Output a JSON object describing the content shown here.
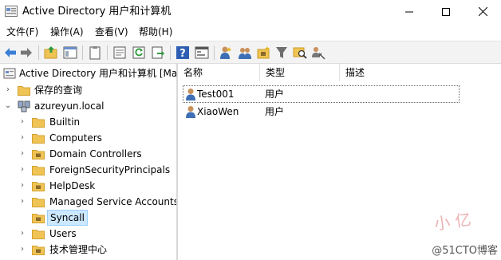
{
  "window": {
    "title": "Active Directory 用户和计算机",
    "controls": {
      "minimize": "minimize-icon",
      "maximize": "maximize-icon",
      "close": "close-icon"
    }
  },
  "menu": [
    {
      "label": "文件(F)"
    },
    {
      "label": "操作(A)"
    },
    {
      "label": "查看(V)"
    },
    {
      "label": "帮助(H)"
    }
  ],
  "toolbar": {
    "icons": [
      "back-arrow-icon",
      "forward-arrow-icon",
      "up-folder-icon",
      "show-tree-icon",
      "clipboard-icon",
      "properties-icon",
      "refresh-icon",
      "export-list-icon",
      "help-icon",
      "console-icon",
      "new-user-icon",
      "new-group-icon",
      "new-ou-icon",
      "filter-icon",
      "find-icon",
      "delegate-icon"
    ]
  },
  "tree": {
    "root_label": "Active Directory 用户和计算机 [Ma",
    "saved_queries": "保存的查询",
    "domain": "azureyun.local",
    "children": [
      {
        "label": "Builtin",
        "type": "folder"
      },
      {
        "label": "Computers",
        "type": "folder"
      },
      {
        "label": "Domain Controllers",
        "type": "ou"
      },
      {
        "label": "ForeignSecurityPrincipals",
        "type": "folder"
      },
      {
        "label": "HelpDesk",
        "type": "ou"
      },
      {
        "label": "Managed Service Accounts",
        "type": "folder"
      },
      {
        "label": "Syncall",
        "type": "ou",
        "selected": true
      },
      {
        "label": "Users",
        "type": "folder"
      },
      {
        "label": "技术管理中心",
        "type": "ou"
      }
    ]
  },
  "list": {
    "columns": [
      "名称",
      "类型",
      "描述"
    ],
    "rows": [
      {
        "name": "Test001",
        "type": "用户",
        "description": ""
      },
      {
        "name": "XiaoWen",
        "type": "用户",
        "description": ""
      }
    ]
  },
  "colors": {
    "selection": "#cce8ff",
    "selection_border": "#99d1ff",
    "folder": "#f0c454",
    "folder_dark": "#d9a528"
  },
  "watermark": "@51CTO博客"
}
